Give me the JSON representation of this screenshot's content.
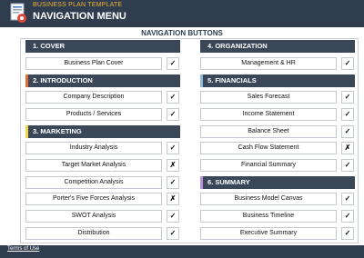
{
  "header": {
    "subtitle": "BUSINESS PLAN TEMPLATE",
    "title": "NAVIGATION MENU",
    "logo_icon": "business-plan-document-icon"
  },
  "panel_title": "NAVIGATION BUTTONS",
  "colors": {
    "header_bg": "#2f3d4f",
    "section_bg": "#3a4759",
    "subtitle": "#f2b134",
    "accent_cover": "#3a4759",
    "accent_intro": "#e0703a",
    "accent_marketing": "#f2d24a",
    "accent_organization": "#3a4759",
    "accent_financials": "#8fb6d8",
    "accent_summary": "#b98fd6"
  },
  "sections": {
    "cover": {
      "label": "1. COVER",
      "items": [
        {
          "label": "Business Plan Cover",
          "status": "✓"
        }
      ]
    },
    "introduction": {
      "label": "2. INTRODUCTION",
      "items": [
        {
          "label": "Company Description",
          "status": "✓"
        },
        {
          "label": "Products / Services",
          "status": "✓"
        }
      ]
    },
    "marketing": {
      "label": "3. MARKETING",
      "items": [
        {
          "label": "Industry Analysis",
          "status": "✓"
        },
        {
          "label": "Target Market Analysis",
          "status": "✗"
        },
        {
          "label": "Competition Analysis",
          "status": "✓"
        },
        {
          "label": "Porter's Five Forces Analysis",
          "status": "✗"
        },
        {
          "label": "SWOT Analysis",
          "status": "✓"
        },
        {
          "label": "Distribution",
          "status": "✓"
        }
      ]
    },
    "organization": {
      "label": "4. ORGANIZATION",
      "items": [
        {
          "label": "Management & HR",
          "status": "✓"
        }
      ]
    },
    "financials": {
      "label": "5. FINANCIALS",
      "items": [
        {
          "label": "Sales Forecast",
          "status": "✓"
        },
        {
          "label": "Income Statement",
          "status": "✓"
        },
        {
          "label": "Balance Sheet",
          "status": "✓"
        },
        {
          "label": "Cash Flow Statement",
          "status": "✗"
        },
        {
          "label": "Financial Summary",
          "status": "✓"
        }
      ]
    },
    "summary": {
      "label": "6. SUMMARY",
      "items": [
        {
          "label": "Business Model Canvas",
          "status": "✓"
        },
        {
          "label": "Business Timeline",
          "status": "✓"
        },
        {
          "label": "Executive Summary",
          "status": "✓"
        }
      ]
    }
  },
  "footer": {
    "terms_label": "Terms of Use"
  }
}
